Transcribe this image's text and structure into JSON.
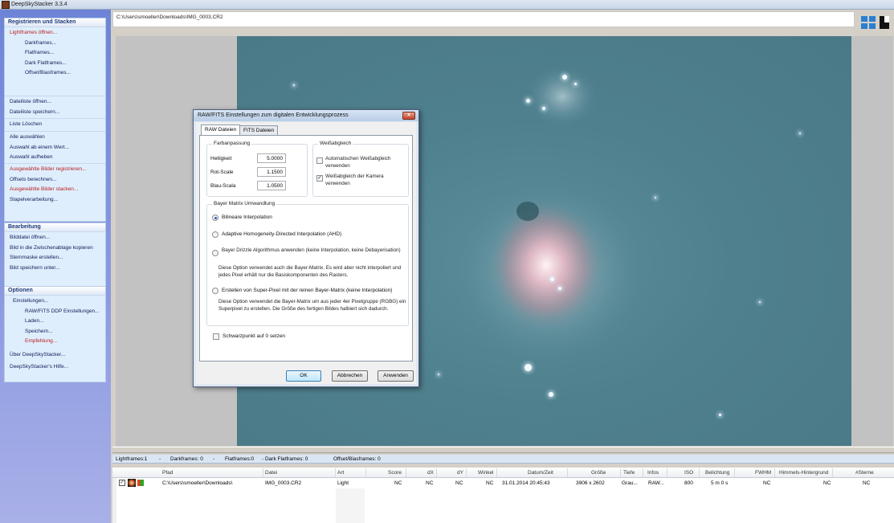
{
  "window": {
    "title": "DeepSkyStacker 3.3.4"
  },
  "path": "C:\\Users\\smoeller\\Downloads\\IMG_0003.CR2",
  "sidebar": {
    "register_title": "Registrieren und Stacken",
    "register_items": [
      "Lightframes öffnen...",
      "Darkframes...",
      "Flatframes...",
      "Dark Flatframes...",
      "Offset/Biasframes...",
      "Dateiliste öffnen...",
      "Dateiliste speichern...",
      "Liste Löschen",
      "Alle auswählen",
      "Auswahl ab einem Wert...",
      "Auswahl aufheben",
      "Ausgewählte Bilder registrieren...",
      "Offsets berechnen...",
      "Ausgewählte Bilder stacken...",
      "Stapelverarbeitung..."
    ],
    "edit_title": "Bearbeitung",
    "edit_items": [
      "Bilddatei öffnen...",
      "Bild in die Zwischenablage kopieren",
      "Sternmaske erstellen...",
      "Bild speichern unter..."
    ],
    "options_title": "Optionen",
    "options_items": [
      "Einstellungen...",
      "RAW/FITS DDP Einstellungen...",
      "Laden...",
      "Speichern...",
      "Empfehlung...",
      "Über DeepSkyStacker...",
      "DeepSkyStacker's Hilfe..."
    ]
  },
  "dialog": {
    "title": "RAW/FITS Einstellungen zum digitalen Entwicklungsprozess",
    "tabs": [
      "RAW Dateien",
      "FITS Dateien"
    ],
    "color_group": "Farbanpassung",
    "brightness_label": "Helligkeit",
    "brightness_value": "5.0000",
    "red_label": "Rot-Scale",
    "red_value": "1.1500",
    "blue_label": "Blau-Scala",
    "blue_value": "1.0500",
    "wb_group": "Weißabgleich",
    "wb_auto": "Automatischen Weißabgleich verwenden",
    "wb_camera": "Weißabgleich der Kamera verwenden",
    "bayer_group": "Bayer Matrix Umwandlung",
    "opt_bilinear": "Bilineare Interpolation",
    "opt_ahd": "Adaptive Homogeneity-Directed Interpolation (AHD)",
    "opt_drizzle": "Bayer Drizzle Algorithmus anwenden (keine Interpolation, keine Debayerisation)",
    "opt_drizzle_desc": "Diese Option verwendet auch die Bayer-Matrix. Es wird aber nicht interpoliert und jedes Pixel erhält nur die Basiskomponenten des Rasters.",
    "opt_superpixel": "Erstellen von Super-Pixel mit der reinen Bayer-Matrix (keine Interpolation)",
    "opt_superpixel_desc": "Diese Option verwendet die Bayer-Matrix um aus jeder 4er Pixelgruppe (RGBG) ein Superpixel zu erstellen. Die Größe des fertigen Bildes halbiert sich dadurch.",
    "black_point": "Schwarzpunkt auf 0 setzen",
    "ok": "OK",
    "cancel": "Abbrechen",
    "apply": "Anwenden"
  },
  "status": {
    "light": "Lightframes:1",
    "dash": "-",
    "dark": "Darkframes: 0",
    "flat": "Flatframes:0",
    "darkflat": "- Dark Flatframes: 0",
    "offset": "Offset/Biasframes: 0"
  },
  "columns": [
    "Pfad",
    "Datei",
    "Art",
    "Score",
    "dX",
    "dY",
    "Winkel",
    "Datum/Zeit",
    "Größe",
    "Tiefe",
    "Infos",
    "ISO",
    "Belichtung",
    "FWHM",
    "Himmels-Hintergrund",
    "#Sterne"
  ],
  "row": {
    "path": "C:\\Users\\smoeller\\Downloads\\",
    "file": "IMG_0003.CR2",
    "type": "Light",
    "score": "NC",
    "dx": "NC",
    "dy": "NC",
    "angle": "NC",
    "datetime": "31.01.2014 20:45:43",
    "size": "3906 x 2602",
    "depth": "Grau...",
    "info": "RAW...",
    "iso": "800",
    "exposure": "5 m 0 s",
    "fwhm": "NC",
    "sky": "NC",
    "stars": "NC"
  },
  "colors": {
    "sidebar": "#7d8fda",
    "photo": "#4f808e",
    "dialog_title": "#c8d8ee",
    "accent_red": "#b71e1e"
  }
}
